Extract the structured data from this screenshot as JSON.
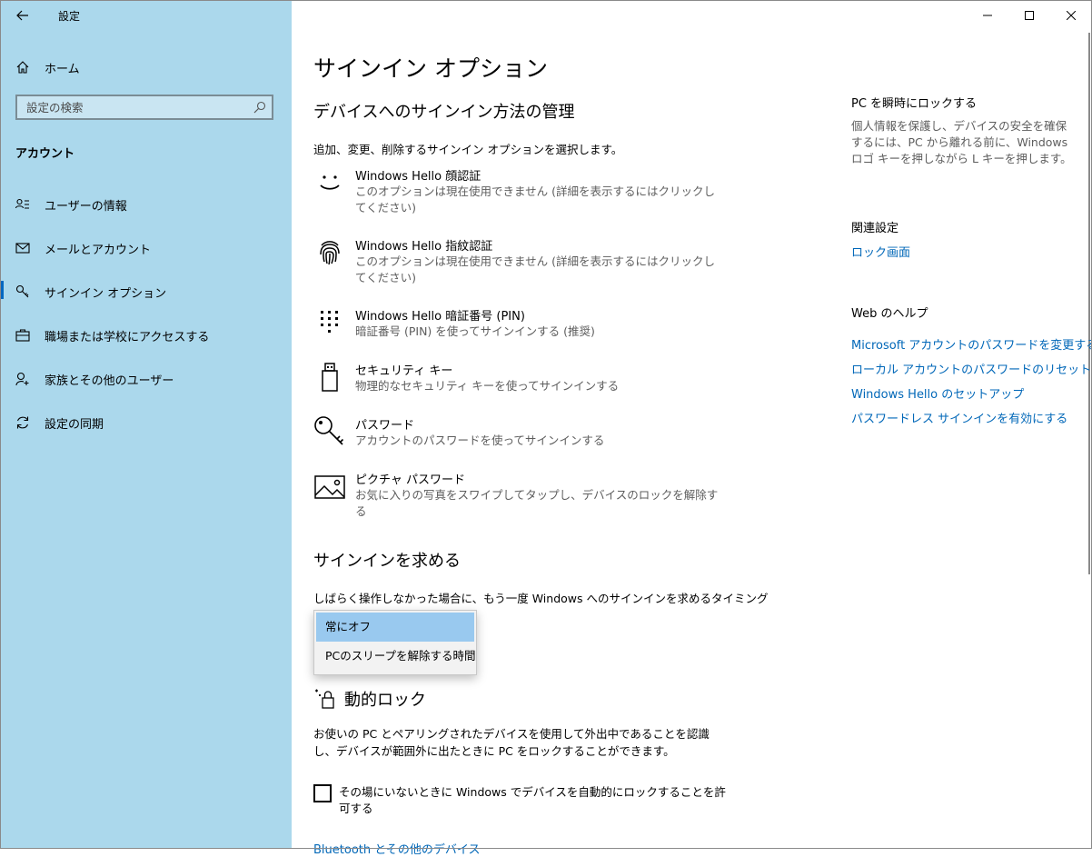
{
  "window": {
    "app_title": "設定"
  },
  "sidebar": {
    "home_label": "ホーム",
    "search_placeholder": "設定の検索",
    "section_label": "アカウント",
    "items": [
      {
        "label": "ユーザーの情報",
        "icon": "user-info-icon"
      },
      {
        "label": "メールとアカウント",
        "icon": "mail-icon"
      },
      {
        "label": "サインイン オプション",
        "icon": "key-icon",
        "active": true
      },
      {
        "label": "職場または学校にアクセスする",
        "icon": "briefcase-icon"
      },
      {
        "label": "家族とその他のユーザー",
        "icon": "add-user-icon"
      },
      {
        "label": "設定の同期",
        "icon": "sync-icon"
      }
    ]
  },
  "main": {
    "title": "サインイン オプション",
    "manage_heading": "デバイスへのサインイン方法の管理",
    "manage_desc": "追加、変更、削除するサインイン オプションを選択します。",
    "options": [
      {
        "title": "Windows Hello 顔認証",
        "desc": "このオプションは現在使用できません (詳細を表示するにはクリックしてください)",
        "icon": "face-icon"
      },
      {
        "title": "Windows Hello 指紋認証",
        "desc": "このオプションは現在使用できません (詳細を表示するにはクリックしてください)",
        "icon": "fingerprint-icon"
      },
      {
        "title": "Windows Hello 暗証番号 (PIN)",
        "desc": "暗証番号 (PIN) を使ってサインインする (推奨)",
        "icon": "pin-keypad-icon"
      },
      {
        "title": "セキュリティ キー",
        "desc": "物理的なセキュリティ キーを使ってサインインする",
        "icon": "usb-key-icon"
      },
      {
        "title": "パスワード",
        "desc": "アカウントのパスワードを使ってサインインする",
        "icon": "password-key-icon"
      },
      {
        "title": "ピクチャ パスワード",
        "desc": "お気に入りの写真をスワイプしてタップし、デバイスのロックを解除する",
        "icon": "picture-icon"
      }
    ],
    "require_heading": "サインインを求める",
    "require_desc": "しばらく操作しなかった場合に、もう一度 Windows へのサインインを求めるタイミング",
    "dropdown": {
      "options": [
        "常にオフ",
        "PCのスリープを解除する時間"
      ],
      "selected": "常にオフ"
    },
    "dynamic_lock_heading": "動的ロック",
    "dynamic_lock_desc": "お使いの PC とペアリングされたデバイスを使用して外出中であることを認識し、デバイスが範囲外に出たときに PC をロックすることができます。",
    "dynamic_lock_checkbox": "その場にいないときに Windows でデバイスを自動的にロックすることを許可する",
    "bottom_link": "Bluetooth とその他のデバイス"
  },
  "right": {
    "lock_heading": "PC を瞬時にロックする",
    "lock_desc": "個人情報を保護し、デバイスの安全を確保するには、PC から離れる前に、Windows ロゴ キーを押しながら L キーを押します。",
    "related_heading": "関連設定",
    "related_link": "ロック画面",
    "help_heading": "Web のヘルプ",
    "help_links": [
      "Microsoft アカウントのパスワードを変更する",
      "ローカル アカウントのパスワードのリセット",
      "Windows Hello のセットアップ",
      "パスワードレス サインインを有効にする"
    ]
  },
  "colors": {
    "sidebar_bg": "#abd8ec",
    "accent": "#0067c0",
    "link": "#0067b8",
    "dropdown_selected": "#99c9ef"
  }
}
